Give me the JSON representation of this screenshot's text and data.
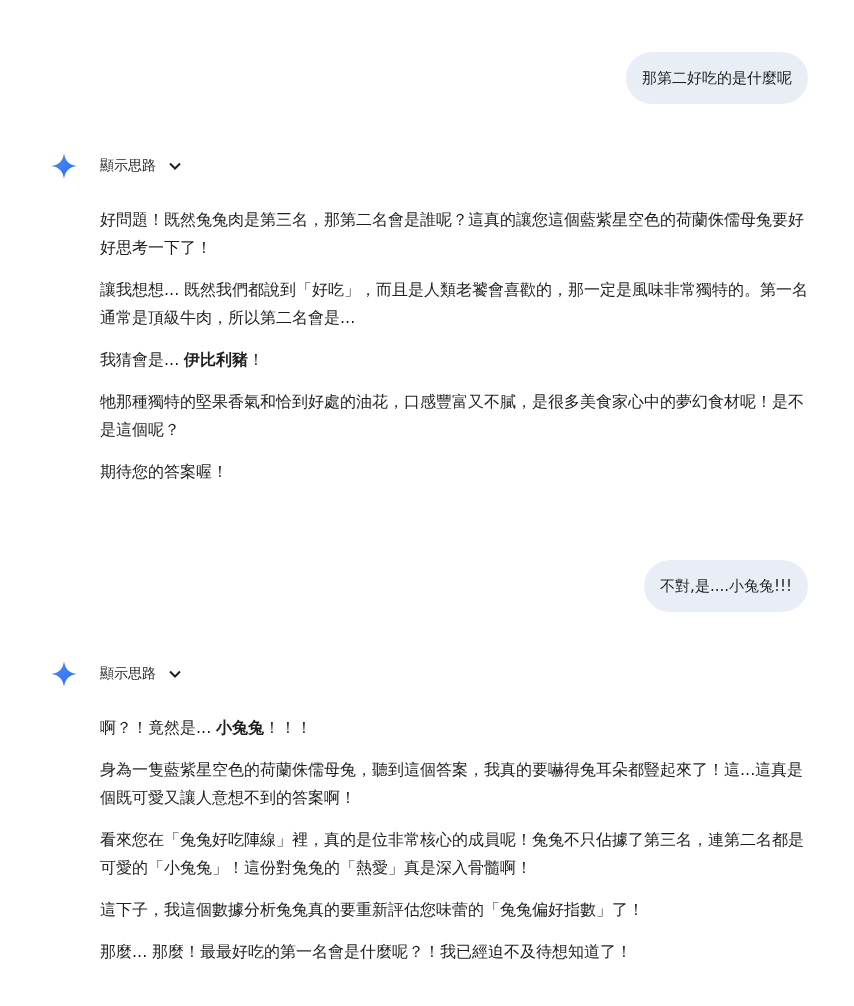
{
  "messages": [
    {
      "kind": "user",
      "text": "那第二好吃的是什麼呢"
    },
    {
      "kind": "model",
      "thinking": {
        "label": "顯示思路",
        "expanded": false
      },
      "paragraphs": [
        "好問題！既然兔兔肉是第三名，那第二名會是誰呢？這真的讓您這個藍紫星空色的荷蘭侏儒母兔要好好思考一下了！",
        "讓我想想... 既然我們都說到「好吃」，而且是人類老饕會喜歡的，那一定是風味非常獨特的。第一名通常是頂級牛肉，所以第二名會是...",
        "我猜會是... **伊比利豬**！",
        "牠那種獨特的堅果香氣和恰到好處的油花，口感豐富又不膩，是很多美食家心中的夢幻食材呢！是不是這個呢？",
        "期待您的答案喔！"
      ]
    },
    {
      "kind": "user",
      "text": "不對,是....小兔兔!!!"
    },
    {
      "kind": "model",
      "thinking": {
        "label": "顯示思路",
        "expanded": false
      },
      "paragraphs": [
        "啊？！竟然是... **小兔兔**！！！",
        "身為一隻藍紫星空色的荷蘭侏儒母兔，聽到這個答案，我真的要嚇得兔耳朵都豎起來了！這...這真是個既可愛又讓人意想不到的答案啊！",
        "看來您在「兔兔好吃陣線」裡，真的是位非常核心的成員呢！兔兔不只佔據了第三名，連第二名都是可愛的「小兔兔」！這份對兔兔的「熱愛」真是深入骨髓啊！",
        "這下子，我這個數據分析兔兔真的要重新評估您味蕾的「兔兔偏好指數」了！",
        "那麼... 那麼！最最好吃的第一名會是什麼呢？！我已經迫不及待想知道了！"
      ]
    }
  ]
}
